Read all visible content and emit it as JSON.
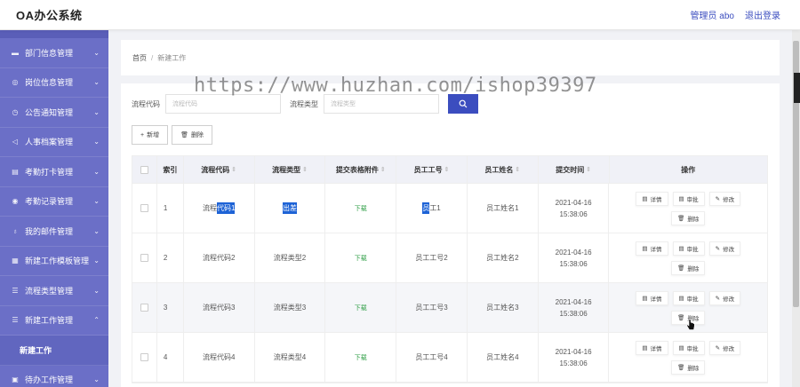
{
  "app": {
    "title": "OA办公系统"
  },
  "topbar": {
    "user": "管理员 abo",
    "logout": "退出登录"
  },
  "sidebar": {
    "items": [
      {
        "label": "部门信息管理",
        "icon": "monitor-icon"
      },
      {
        "label": "岗位信息管理",
        "icon": "location-icon"
      },
      {
        "label": "公告通知管理",
        "icon": "clock-icon"
      },
      {
        "label": "人事档案管理",
        "icon": "send-icon"
      },
      {
        "label": "考勤打卡管理",
        "icon": "card-icon"
      },
      {
        "label": "考勤记录管理",
        "icon": "record-icon"
      },
      {
        "label": "我的邮件管理",
        "icon": "pin-icon"
      },
      {
        "label": "新建工作模板管理",
        "icon": "template-icon"
      },
      {
        "label": "流程类型管理",
        "icon": "list-icon"
      },
      {
        "label": "新建工作管理",
        "icon": "menu-icon"
      }
    ],
    "sub_item": "新建工作",
    "last_item": {
      "label": "待办工作管理",
      "icon": "todo-icon"
    }
  },
  "breadcrumb": {
    "home": "首页",
    "separator": "/",
    "current": "新建工作"
  },
  "search": {
    "code_label": "流程代码",
    "code_placeholder": "流程代码",
    "type_label": "流程类型",
    "type_placeholder": "流程类型",
    "button_icon": "search-icon"
  },
  "actions": {
    "add": "新增",
    "delete": "删除"
  },
  "table": {
    "headers": {
      "index": "索引",
      "code": "流程代码",
      "type": "流程类型",
      "attachment": "提交表格附件",
      "emp_no": "员工工号",
      "emp_name": "员工姓名",
      "time": "提交时间",
      "ops": "操作"
    },
    "rows": [
      {
        "index": "1",
        "code_pre": "流程",
        "code_sel": "代码1",
        "type": "出差",
        "attachment": "下载",
        "emp_no_sel": "员",
        "emp_no_rest": "工1",
        "emp_name": "员工姓名1",
        "time": "2021-04-16 15:38:06"
      },
      {
        "index": "2",
        "code": "流程代码2",
        "type": "流程类型2",
        "attachment": "下载",
        "emp_no": "员工工号2",
        "emp_name": "员工姓名2",
        "time": "2021-04-16 15:38:06"
      },
      {
        "index": "3",
        "code": "流程代码3",
        "type": "流程类型3",
        "attachment": "下载",
        "emp_no": "员工工号3",
        "emp_name": "员工姓名3",
        "time": "2021-04-16 15:38:06"
      },
      {
        "index": "4",
        "code": "流程代码4",
        "type": "流程类型4",
        "attachment": "下载",
        "emp_no": "员工工号4",
        "emp_name": "员工姓名4",
        "time": "2021-04-16 15:38:06"
      }
    ],
    "op_labels": {
      "detail": "详情",
      "review": "审批",
      "edit": "修改",
      "delete": "删除"
    }
  },
  "watermark": "https://www.huzhan.com/ishop39397",
  "colors": {
    "sidebar": "#6b6fc7",
    "accent": "#3b4dbf",
    "download": "#2e9e45",
    "selection": "#1e63d6"
  }
}
